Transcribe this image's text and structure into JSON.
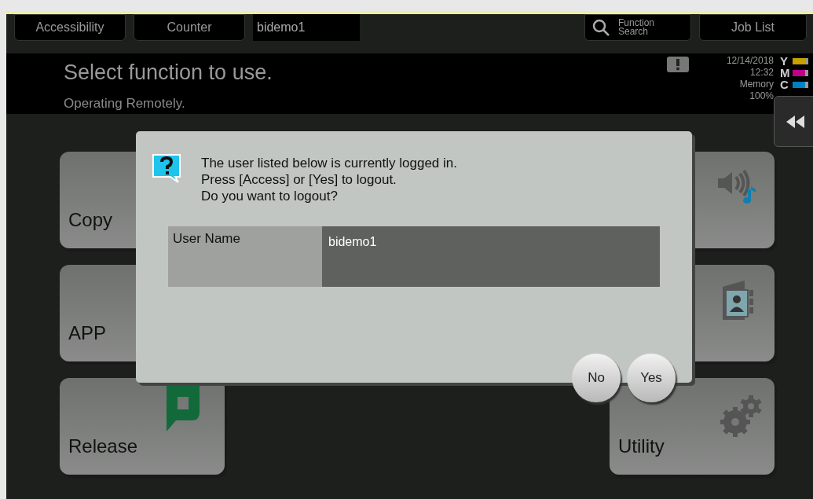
{
  "top_bar": {
    "buttons": [
      {
        "label": "Accessibility"
      },
      {
        "label": "Counter"
      }
    ],
    "user_field": "bidemo1",
    "search_button": {
      "label": "Function Search"
    },
    "job_list_button": {
      "label": "Job List"
    }
  },
  "header": {
    "title": "Select function to use.",
    "subtitle": "Operating Remotely.",
    "date": "12/14/2018",
    "time": "12:32",
    "memory_label": "Memory",
    "memory_value": "100%",
    "toner": [
      {
        "letter": "Y",
        "color": "#c8a000",
        "level": 0.8
      },
      {
        "letter": "M",
        "color": "#c0008a",
        "level": 0.8
      },
      {
        "letter": "C",
        "color": "#0080c0",
        "level": 0.8
      }
    ]
  },
  "left_tiles": [
    {
      "label": "Copy",
      "kind": "plain"
    },
    {
      "label": "APP",
      "kind": "plain"
    },
    {
      "label": "Release",
      "kind": "release"
    }
  ],
  "right_tiles": [
    {
      "kind": "sound"
    },
    {
      "kind": "book"
    },
    {
      "label": "Utility",
      "kind": "gear"
    }
  ],
  "dialog": {
    "message": [
      "The user listed below is currently logged in.",
      "Press [Access] or [Yes] to logout.",
      "Do you want to logout?"
    ],
    "table": {
      "label": "User Name",
      "value": "bidemo1"
    },
    "buttons": [
      {
        "label": "No"
      },
      {
        "label": "Yes"
      }
    ]
  }
}
